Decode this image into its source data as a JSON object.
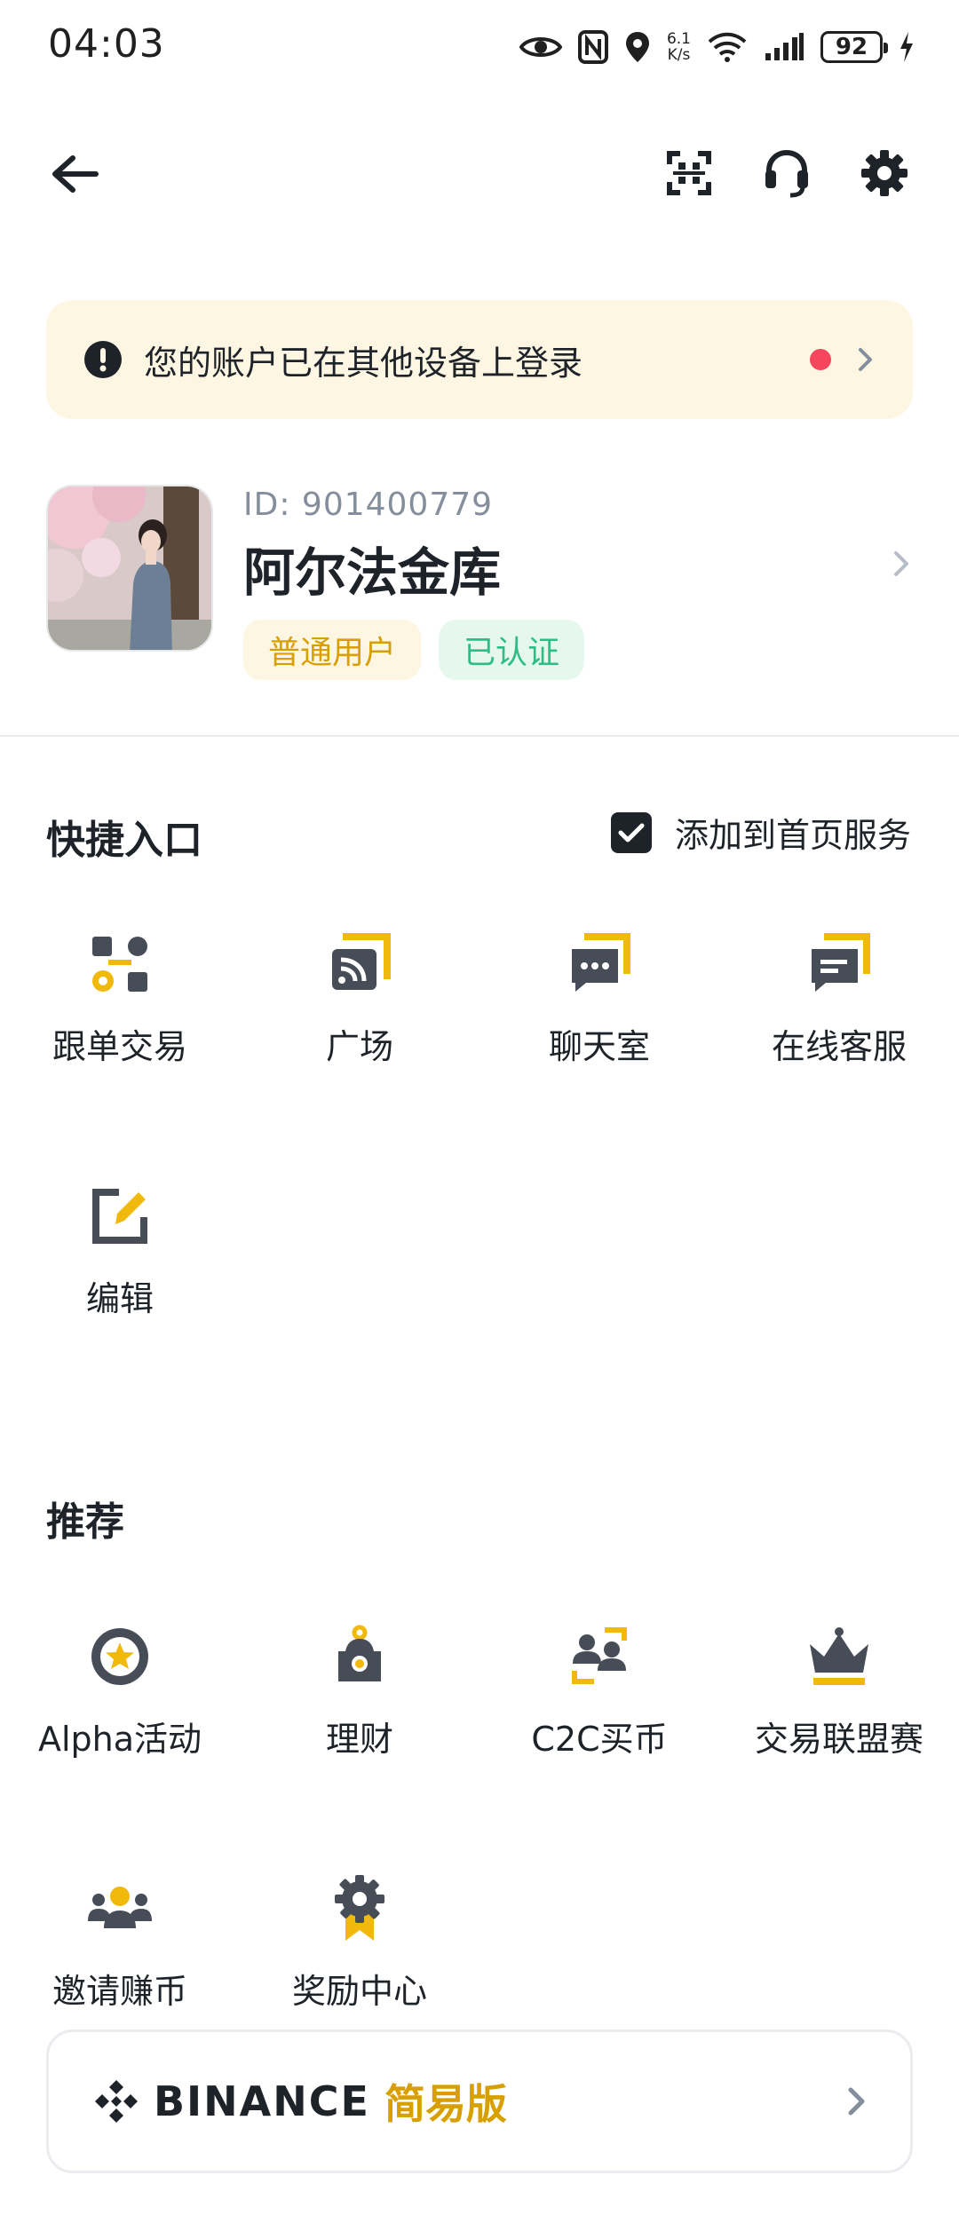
{
  "status_bar": {
    "time": "04:03",
    "net_speed_value": "6.1",
    "net_speed_unit": "K/s",
    "battery": "92",
    "icons": [
      "eye-icon",
      "nfc-icon",
      "location-icon",
      "wifi-icon",
      "signal-icon",
      "battery-icon",
      "charging-icon"
    ]
  },
  "nav": {
    "icons": [
      "back-arrow-icon",
      "scan-icon",
      "headset-icon",
      "gear-icon"
    ]
  },
  "alert": {
    "text": "您的账户已在其他设备上登录",
    "icon": "exclamation-icon",
    "dot_color": "#f6465d"
  },
  "profile": {
    "id_text": "ID: 901400779",
    "name": "阿尔法金库",
    "badges": [
      "普通用户",
      "已认证"
    ]
  },
  "shortcuts": {
    "title": "快捷入口",
    "add_home_label": "添加到首页服务",
    "add_home_checked": true,
    "items": [
      {
        "label": "跟单交易",
        "icon": "copy-trading-icon"
      },
      {
        "label": "广场",
        "icon": "square-broadcast-icon"
      },
      {
        "label": "聊天室",
        "icon": "chat-room-icon"
      },
      {
        "label": "在线客服",
        "icon": "customer-service-icon"
      },
      {
        "label": "编辑",
        "icon": "edit-icon"
      }
    ]
  },
  "recommend": {
    "title": "推荐",
    "items": [
      {
        "label": "Alpha活动",
        "icon": "alpha-star-icon"
      },
      {
        "label": "理财",
        "icon": "finance-icon"
      },
      {
        "label": "C2C买币",
        "icon": "c2c-users-icon"
      },
      {
        "label": "交易联盟赛",
        "icon": "crown-icon"
      },
      {
        "label": "邀请赚币",
        "icon": "invite-users-icon"
      },
      {
        "label": "奖励中心",
        "icon": "reward-badge-icon"
      }
    ]
  },
  "lite": {
    "brand": "BINANCE",
    "label": "简易版"
  },
  "colors": {
    "accent": "#f0b90b",
    "text": "#1e2329",
    "secondary": "#848e9c",
    "success": "#2ebd85"
  }
}
